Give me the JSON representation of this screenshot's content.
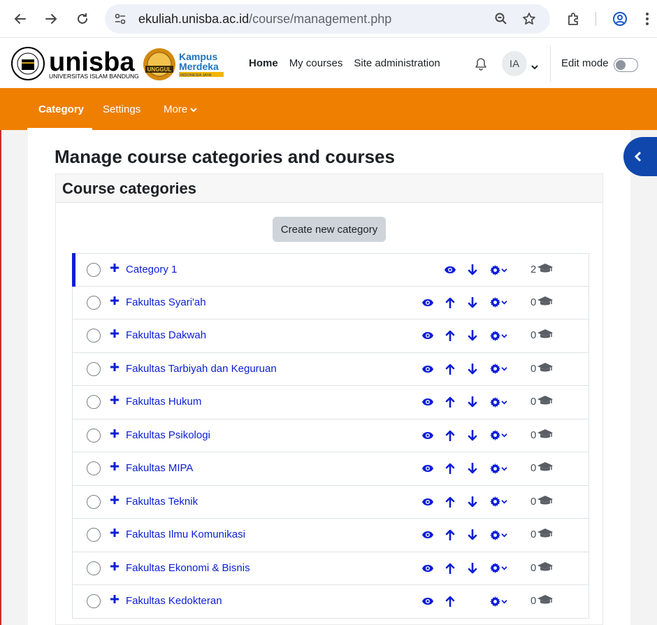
{
  "browser": {
    "url_host": "ekuliah.unisba.ac.id",
    "url_path": "/course/management.php"
  },
  "header": {
    "logo_text": "unisba",
    "logo_subtitle": "UNIVERSITAS ISLAM BANDUNG",
    "badge_text": "UNGGUL",
    "kampus_line1": "Kampus",
    "kampus_line2": "Merdeka",
    "kampus_line3": "INDONESIA JAYA",
    "nav": [
      "Home",
      "My courses",
      "Site administration"
    ],
    "avatar_initials": "IA",
    "edit_mode_label": "Edit mode"
  },
  "secondary_nav": {
    "items": [
      "Category",
      "Settings",
      "More"
    ]
  },
  "page": {
    "title": "Manage course categories and courses",
    "panel_title": "Course categories",
    "create_button": "Create new category"
  },
  "categories": [
    {
      "name": "Category 1",
      "count": "2",
      "show_up": false,
      "show_down": true
    },
    {
      "name": "Fakultas Syari'ah",
      "count": "0",
      "show_up": true,
      "show_down": true
    },
    {
      "name": "Fakultas Dakwah",
      "count": "0",
      "show_up": true,
      "show_down": true
    },
    {
      "name": "Fakultas Tarbiyah dan Keguruan",
      "count": "0",
      "show_up": true,
      "show_down": true
    },
    {
      "name": "Fakultas Hukum",
      "count": "0",
      "show_up": true,
      "show_down": true
    },
    {
      "name": "Fakultas Psikologi",
      "count": "0",
      "show_up": true,
      "show_down": true
    },
    {
      "name": "Fakultas MIPA",
      "count": "0",
      "show_up": true,
      "show_down": true
    },
    {
      "name": "Fakultas Teknik",
      "count": "0",
      "show_up": true,
      "show_down": true
    },
    {
      "name": "Fakultas Ilmu Komunikasi",
      "count": "0",
      "show_up": true,
      "show_down": true
    },
    {
      "name": "Fakultas Ekonomi & Bisnis",
      "count": "0",
      "show_up": true,
      "show_down": true
    },
    {
      "name": "Fakultas Kedokteran",
      "count": "0",
      "show_up": true,
      "show_down": false
    }
  ],
  "colors": {
    "accent_orange": "#ef7f00",
    "link_blue": "#0b1ed6",
    "drawer_blue": "#0f47ad"
  }
}
